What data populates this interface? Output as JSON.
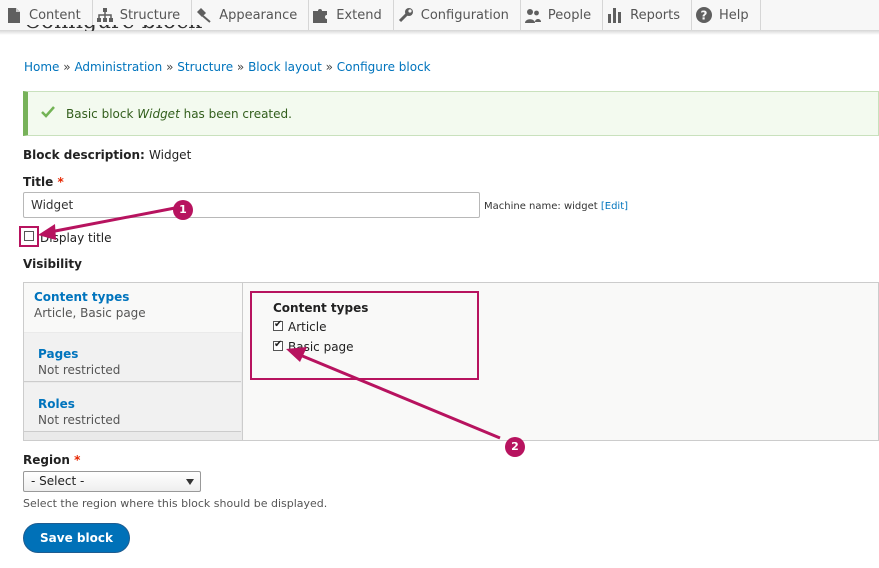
{
  "toolbar": {
    "items": [
      {
        "label": "Content",
        "icon": "page-icon"
      },
      {
        "label": "Structure",
        "icon": "sitemap-icon"
      },
      {
        "label": "Appearance",
        "icon": "brush-icon"
      },
      {
        "label": "Extend",
        "icon": "puzzle-icon"
      },
      {
        "label": "Configuration",
        "icon": "wrench-icon"
      },
      {
        "label": "People",
        "icon": "people-icon"
      },
      {
        "label": "Reports",
        "icon": "bar-chart-icon"
      },
      {
        "label": "Help",
        "icon": "help-icon"
      }
    ]
  },
  "page_title": "Configure block",
  "breadcrumb": {
    "items": [
      "Home",
      "Administration",
      "Structure",
      "Block layout",
      "Configure block"
    ],
    "separator": "»"
  },
  "message": {
    "prefix": "Basic block ",
    "name": "Widget",
    "suffix": " has been created."
  },
  "block_description": {
    "label": "Block description:",
    "value": "Widget"
  },
  "title_field": {
    "label": "Title",
    "required_mark": "*",
    "value": "Widget",
    "machine_label": "Machine name: widget",
    "edit_link": "[Edit]"
  },
  "display_title": {
    "label": "Display title",
    "checked": false
  },
  "visibility": {
    "heading": "Visibility",
    "tabs": [
      {
        "title": "Content types",
        "summary": "Article, Basic page"
      },
      {
        "title": "Pages",
        "summary": "Not restricted"
      },
      {
        "title": "Roles",
        "summary": "Not restricted"
      }
    ],
    "content_types": {
      "heading": "Content types",
      "options": [
        {
          "label": "Article",
          "checked": true
        },
        {
          "label": "Basic page",
          "checked": true
        }
      ]
    }
  },
  "region": {
    "label": "Region",
    "required_mark": "*",
    "selected": "- Select -",
    "description": "Select the region where this block should be displayed."
  },
  "save_button": "Save block",
  "annotations": {
    "badge_1": "1",
    "badge_2": "2",
    "color": "#b7135f"
  },
  "colors": {
    "link": "#0074bd",
    "primary_button": "#0071b8",
    "success_border": "#77b259"
  }
}
